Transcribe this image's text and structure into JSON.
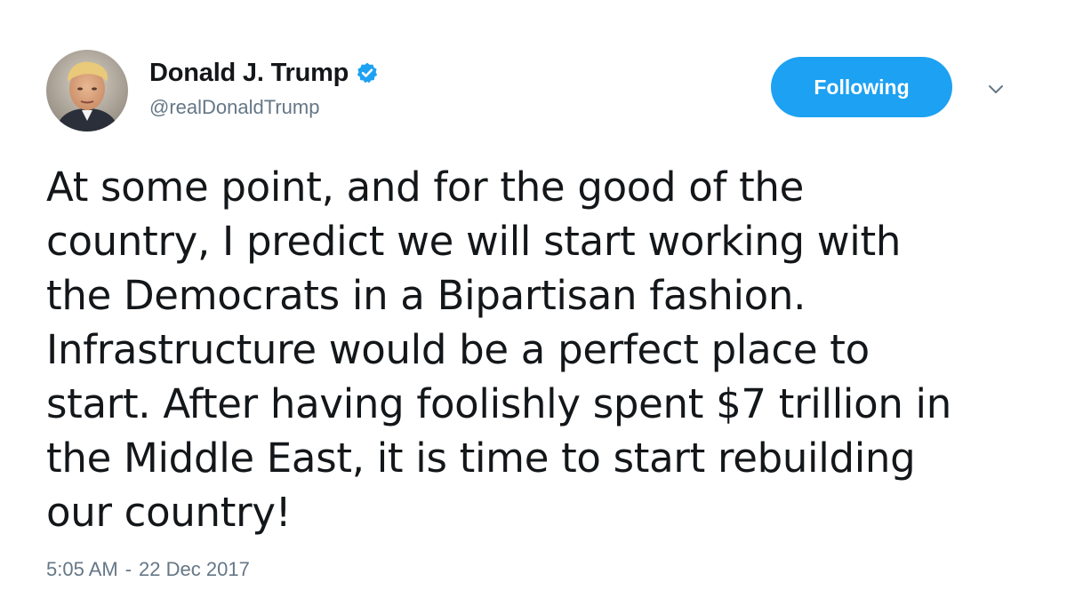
{
  "tweet": {
    "author": {
      "display_name": "Donald J. Trump",
      "handle": "@realDonaldTrump",
      "verified": true,
      "verified_icon": "verified-badge-icon",
      "avatar_icon": "avatar"
    },
    "follow_button_label": "Following",
    "menu_icon": "chevron-down-icon",
    "text_lines": [
      "At some point, and for the good of the",
      "country, I predict we will start working with",
      "the Democrats in a Bipartisan fashion.",
      "Infrastructure would be a perfect place to",
      "start. After having foolishly spent $7 trillion in",
      "the Middle East, it is time to start rebuilding",
      "our country!"
    ],
    "time": "5:05 AM",
    "separator": "-",
    "date": "22 Dec 2017"
  },
  "colors": {
    "accent": "#1da1f2",
    "text": "#14171a",
    "muted": "#657786"
  }
}
